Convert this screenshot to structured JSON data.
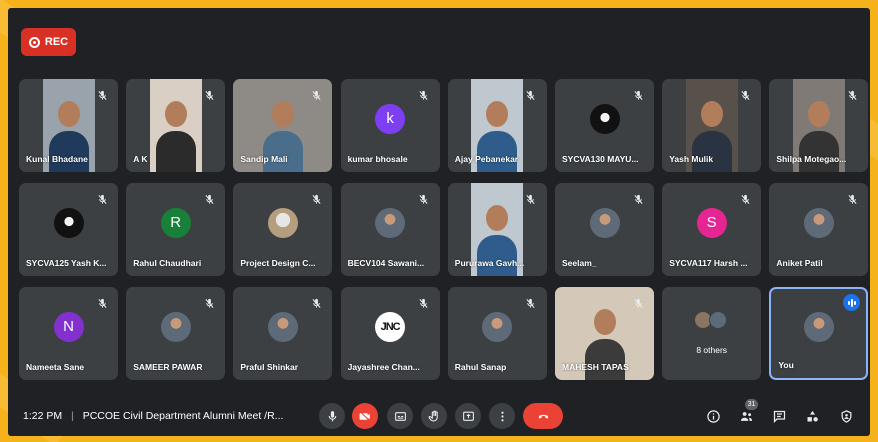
{
  "recording": {
    "label": "REC"
  },
  "participants": [
    {
      "name": "Kunal Bhadane",
      "type": "video",
      "muted": true
    },
    {
      "name": "A K",
      "type": "video",
      "muted": true
    },
    {
      "name": "Sandip Mali",
      "type": "video",
      "muted": true
    },
    {
      "name": "kumar bhosale",
      "type": "letter",
      "initial": "k",
      "color": "#7e3ff2",
      "muted": true
    },
    {
      "name": "Ajay Pebanekar",
      "type": "video",
      "muted": true
    },
    {
      "name": "SYCVA130 MAYU...",
      "type": "logo",
      "muted": true
    },
    {
      "name": "Yash Mulik",
      "type": "video",
      "muted": true
    },
    {
      "name": "Shilpa Motegao...",
      "type": "video",
      "muted": true
    },
    {
      "name": "SYCVA125 Yash K...",
      "type": "photo-dark",
      "muted": true
    },
    {
      "name": "Rahul Chaudhari",
      "type": "letter",
      "initial": "R",
      "color": "#188038",
      "muted": true
    },
    {
      "name": "Project Design C...",
      "type": "photo-house",
      "muted": true
    },
    {
      "name": "BECV104 Sawani...",
      "type": "photo",
      "muted": true
    },
    {
      "name": "Pururawa Gavh...",
      "type": "video",
      "muted": true
    },
    {
      "name": "Seelam_",
      "type": "photo",
      "muted": true
    },
    {
      "name": "SYCVA117 Harsh ...",
      "type": "letter",
      "initial": "S",
      "color": "#e52592",
      "muted": true
    },
    {
      "name": "Aniket Patil",
      "type": "photo",
      "muted": true
    },
    {
      "name": "Nameeta Sane",
      "type": "letter",
      "initial": "N",
      "color": "#8430ce",
      "muted": true
    },
    {
      "name": "SAMEER PAWAR",
      "type": "photo",
      "muted": true
    },
    {
      "name": "Praful Shinkar",
      "type": "photo",
      "muted": true
    },
    {
      "name": "Jayashree Chan...",
      "type": "jnc",
      "initial": "JNC",
      "muted": true
    },
    {
      "name": "Rahul Sanap",
      "type": "photo",
      "muted": true
    },
    {
      "name": "MAHESH TAPAS",
      "type": "video",
      "muted": true
    },
    {
      "name": "8 others",
      "type": "others",
      "muted": false
    },
    {
      "name": "You",
      "type": "photo",
      "muted": false,
      "speaking": true
    }
  ],
  "bottom_bar": {
    "time": "1:22 PM",
    "separator": "|",
    "meeting_title": "PCCOE Civil Department Alumni Meet /R...",
    "participant_count": "31"
  },
  "colors": {
    "background": "#202124",
    "tile": "#3c4043",
    "accent_red": "#ea4335",
    "accent_blue": "#1a73e8",
    "outer": "#f5b21a"
  },
  "icons": {
    "controls": [
      "mic-icon",
      "camera-off-icon",
      "captions-icon",
      "raise-hand-icon",
      "present-icon",
      "more-options-icon",
      "end-call-icon"
    ],
    "right": [
      "info-icon",
      "people-icon",
      "chat-icon",
      "activities-icon",
      "host-controls-icon"
    ]
  }
}
